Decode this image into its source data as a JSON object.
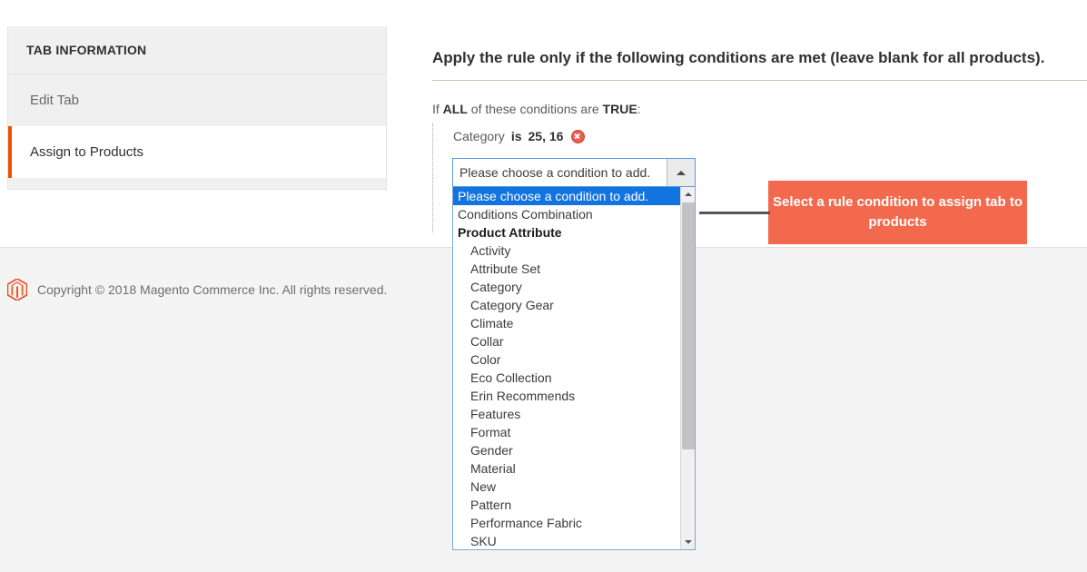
{
  "sidebar": {
    "header_title": "TAB INFORMATION",
    "items": [
      {
        "label": "Edit Tab",
        "active": false
      },
      {
        "label": "Assign to Products",
        "active": true
      }
    ]
  },
  "main": {
    "title": "Apply the rule only if the following conditions are met (leave blank for all products).",
    "rule_intro": {
      "prefix": "If",
      "aggregator": "ALL",
      "middle": "of these conditions are",
      "value": "TRUE",
      "suffix": ":"
    },
    "conditions": [
      {
        "attribute": "Category",
        "operator": "is",
        "value": "25, 16",
        "remove_icon": "remove-circle-icon"
      }
    ]
  },
  "condition_select": {
    "value": "Please choose a condition to add.",
    "arrow_icon": "triangle-up-icon",
    "options": [
      {
        "label": "Please choose a condition to add.",
        "type": "option",
        "selected": true
      },
      {
        "label": "Conditions Combination",
        "type": "option",
        "selected": false
      },
      {
        "label": "Product Attribute",
        "type": "group",
        "selected": false
      },
      {
        "label": "Activity",
        "type": "option-indent",
        "selected": false
      },
      {
        "label": "Attribute Set",
        "type": "option-indent",
        "selected": false
      },
      {
        "label": "Category",
        "type": "option-indent",
        "selected": false
      },
      {
        "label": "Category Gear",
        "type": "option-indent",
        "selected": false
      },
      {
        "label": "Climate",
        "type": "option-indent",
        "selected": false
      },
      {
        "label": "Collar",
        "type": "option-indent",
        "selected": false
      },
      {
        "label": "Color",
        "type": "option-indent",
        "selected": false
      },
      {
        "label": "Eco Collection",
        "type": "option-indent",
        "selected": false
      },
      {
        "label": "Erin Recommends",
        "type": "option-indent",
        "selected": false
      },
      {
        "label": "Features",
        "type": "option-indent",
        "selected": false
      },
      {
        "label": "Format",
        "type": "option-indent",
        "selected": false
      },
      {
        "label": "Gender",
        "type": "option-indent",
        "selected": false
      },
      {
        "label": "Material",
        "type": "option-indent",
        "selected": false
      },
      {
        "label": "New",
        "type": "option-indent",
        "selected": false
      },
      {
        "label": "Pattern",
        "type": "option-indent",
        "selected": false
      },
      {
        "label": "Performance Fabric",
        "type": "option-indent",
        "selected": false
      },
      {
        "label": "SKU",
        "type": "option-indent",
        "selected": false
      }
    ],
    "scroll_up_icon": "scroll-up-arrow-icon",
    "scroll_down_icon": "scroll-down-arrow-icon"
  },
  "callout": {
    "text": "Select a rule condition to assign tab to products",
    "background": "#f2694d",
    "text_color": "#ffffff"
  },
  "footer": {
    "logo_icon": "magento-logo-icon",
    "copyright": "Copyright © 2018 Magento Commerce Inc. All rights reserved."
  },
  "colors": {
    "accent_orange": "#eb5202",
    "select_highlight": "#1274e0",
    "panel_gray": "#f0f0f0"
  }
}
